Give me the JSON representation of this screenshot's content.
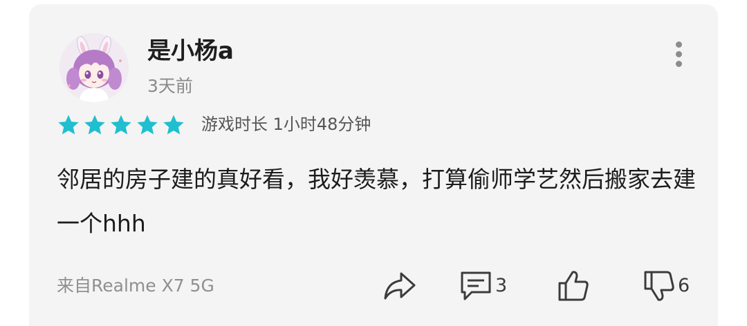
{
  "review": {
    "user_name": "是小杨a",
    "time_ago": "3天前",
    "rating": 5,
    "rating_max": 5,
    "playtime": "游戏时长 1小时48分钟",
    "content": "邻居的房子建的真好看，我好羡慕，打算偷师学艺然后搬家去建一个hhh",
    "device": "来自Realme X7 5G",
    "comment_count": "3",
    "dislike_count": "6"
  },
  "colors": {
    "card_bg": "#f4f4f4",
    "star": "#1fbfcf",
    "icon": "#3b3b3b"
  },
  "icons": [
    "more-vertical-icon",
    "star-icon",
    "share-icon",
    "comment-icon",
    "thumbs-up-icon",
    "thumbs-down-icon"
  ]
}
